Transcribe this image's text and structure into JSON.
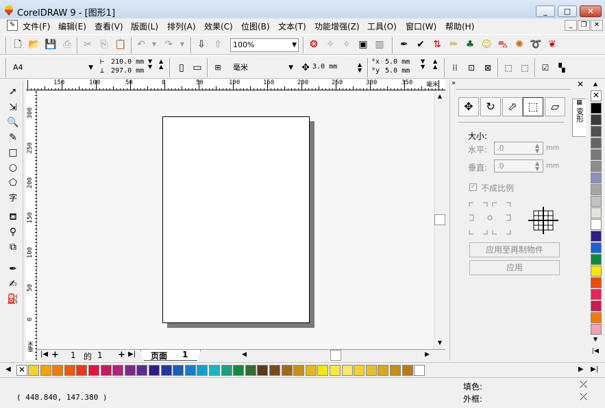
{
  "window": {
    "title": "CorelDRAW 9 - [图形1]",
    "minimize": "_",
    "restore": "□",
    "close": "✕"
  },
  "menu": {
    "items": [
      "文件(F)",
      "编辑(E)",
      "查看(V)",
      "版面(L)",
      "排列(A)",
      "效果(C)",
      "位图(B)",
      "文本(T)",
      "功能增强(Z)",
      "工具(O)",
      "窗口(W)",
      "帮助(H)"
    ],
    "mdi_min": "_",
    "mdi_restore": "❐",
    "mdi_close": "✕"
  },
  "standard_toolbar": {
    "zoom_value": "100%"
  },
  "property_bar": {
    "paper_size": "A4",
    "width": "210.0",
    "height": "297.0",
    "unit_mm": "mm",
    "units": "毫米",
    "nudge": "3.0",
    "nudge_unit": "mm",
    "dup_x": "5.0",
    "dup_y": "5.0",
    "dup_unit": "mm"
  },
  "rulers": {
    "unit_label": "毫米",
    "top_ticks": [
      "150",
      "100",
      "50",
      "0",
      "50",
      "100",
      "150",
      "200",
      "250",
      "300",
      "350"
    ],
    "left_ticks": [
      "300",
      "250",
      "200",
      "150",
      "100",
      "50",
      "0"
    ]
  },
  "page_nav": {
    "current": "1",
    "of": "的",
    "total": "1",
    "tab_label": "页面",
    "tab_num": "1"
  },
  "docker": {
    "tab_title": "变形",
    "size_label": "大小:",
    "horizontal_label": "水平:",
    "horizontal_value": ".0",
    "vertical_label": "垂直:",
    "vertical_value": ".0",
    "unit": "mm",
    "proportional_label": "不成比例",
    "apply_duplicate": "应用至再制物件",
    "apply": "应用"
  },
  "status": {
    "coordinates": "( 448.840, 147.380 )",
    "fill_label": "填色:",
    "outline_label": "外框:"
  },
  "colors": {
    "vertical_palette": [
      "#000000",
      "#3b3b3b",
      "#505050",
      "#666666",
      "#7a7a7a",
      "#8c8c8c",
      "#8e8fc0",
      "#a6a6a6",
      "#c3c3c3",
      "#e1e5de",
      "#ffffff",
      "#2f1d86",
      "#1565d8",
      "#0a8b3b",
      "#f7e600",
      "#ef4a00",
      "#e8245a",
      "#c71f4d",
      "#ef7d00",
      "#f6a0b5"
    ],
    "horizontal_palette": [
      "#f5d22a",
      "#f2a200",
      "#ef7b00",
      "#ef5a00",
      "#e83a1a",
      "#e2163b",
      "#c7195d",
      "#b4207d",
      "#7d2a8c",
      "#5a2d91",
      "#2f1d86",
      "#1d3a9c",
      "#1a5fb6",
      "#127ec7",
      "#0e9fd2",
      "#11b6c7",
      "#1aa37a",
      "#0f8b3b",
      "#2f6f2f",
      "#5b3a1a",
      "#7a4a1a",
      "#a06a18",
      "#c99018",
      "#e5b81a",
      "#f7e600",
      "#f9ea3a",
      "#fbe769",
      "#f5d22a",
      "#e8c02a",
      "#d8a71a",
      "#c88f18",
      "#b87a18",
      "#ffffff"
    ]
  }
}
